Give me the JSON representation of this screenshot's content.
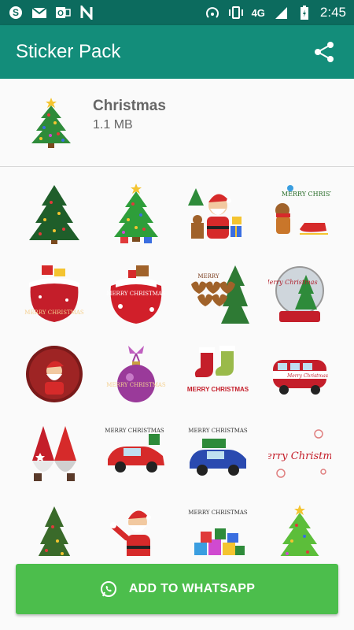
{
  "status_bar": {
    "network": "4G",
    "time": "2:45",
    "left_icons": [
      "skype-icon",
      "gmail-icon",
      "outlook-icon",
      "n-app-icon"
    ],
    "right_icons": [
      "hotspot-icon",
      "vibrate-icon",
      "signal-icon",
      "battery-charging-icon"
    ]
  },
  "app_bar": {
    "title": "Sticker Pack",
    "share_icon": "share-icon"
  },
  "pack": {
    "name": "Christmas",
    "size": "1.1 MB",
    "tray_icon": "christmas-tree-icon"
  },
  "stickers": [
    {
      "name": "christmas-tree-dark",
      "caption": ""
    },
    {
      "name": "christmas-tree-decorated",
      "caption": ""
    },
    {
      "name": "santa-with-gifts",
      "caption": ""
    },
    {
      "name": "reindeer-sleigh",
      "caption": "MERRY CHRISTMAS"
    },
    {
      "name": "gift-sack-red",
      "caption": "MERRY CHRISTMAS"
    },
    {
      "name": "gift-sack-santa",
      "caption": "MERRY CHRISTMAS"
    },
    {
      "name": "gingerbread-hearts-tree",
      "caption": "MERRY"
    },
    {
      "name": "snow-globe",
      "caption": "Merry Christmas"
    },
    {
      "name": "santa-ornament-ball",
      "caption": ""
    },
    {
      "name": "purple-ornament",
      "caption": "MERRY CHRISTMAS"
    },
    {
      "name": "stockings",
      "caption": "MERRY CHRISTMAS"
    },
    {
      "name": "vw-bus",
      "caption": "Merry Christmas"
    },
    {
      "name": "gnomes",
      "caption": ""
    },
    {
      "name": "red-vintage-car",
      "caption": "MERRY CHRISTMAS"
    },
    {
      "name": "blue-vintage-car",
      "caption": "MERRY CHRISTMAS"
    },
    {
      "name": "merry-christmas-script",
      "caption": "Merry Christmas"
    },
    {
      "name": "christmas-tree-tall",
      "caption": ""
    },
    {
      "name": "santa-waving",
      "caption": ""
    },
    {
      "name": "gift-boxes-pile",
      "caption": "MERRY CHRISTMAS"
    },
    {
      "name": "christmas-tree-bright",
      "caption": ""
    }
  ],
  "colors": {
    "status_bar": "#0c6b5e",
    "app_bar": "#138d7a",
    "button": "#4cbe4c"
  },
  "add_button": {
    "label": "ADD TO WHATSAPP",
    "icon": "whatsapp-icon"
  }
}
